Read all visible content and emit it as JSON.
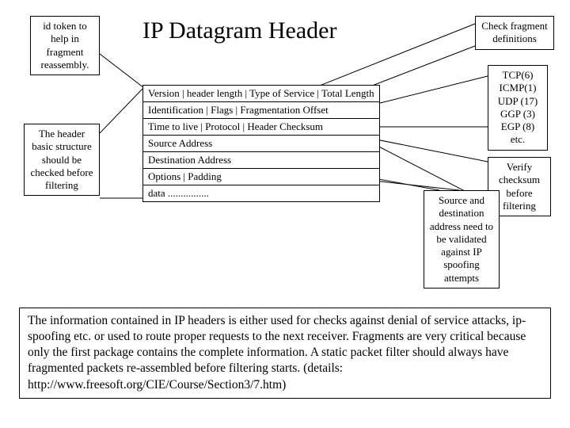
{
  "title": "IP Datagram Header",
  "annotations": {
    "id_token": "id token to help in fragment reassembly.",
    "header_basic": "The header basic structure should be checked before filtering",
    "check_frag": "Check fragment definitions",
    "protocols": "TCP(6)\nICMP(1)\nUDP (17)\nGGP (3)\nEGP (8)\netc.",
    "verify_checksum": "Verify checksum before filtering",
    "src_dst": "Source and destination address need to be validated against IP spoofing attempts"
  },
  "header_rows": {
    "r0": "Version |  header length | Type of Service | Total Length",
    "r1": "Identification  |  Flags | Fragmentation Offset",
    "r2": "Time to live  |  Protocol  |  Header Checksum",
    "r3": "Source Address",
    "r4": "Destination Address",
    "r5": "Options   |   Padding",
    "r6": "data ................"
  },
  "paragraph": "The information contained in IP headers is either used for checks against denial of service attacks, ip-spoofing etc. or used to route proper requests to the next receiver. Fragments are very critical because only the first package contains the complete information. A static packet filter should always have fragmented packets re-assembled before filtering starts. (details: http://www.freesoft.org/CIE/Course/Section3/7.htm)"
}
